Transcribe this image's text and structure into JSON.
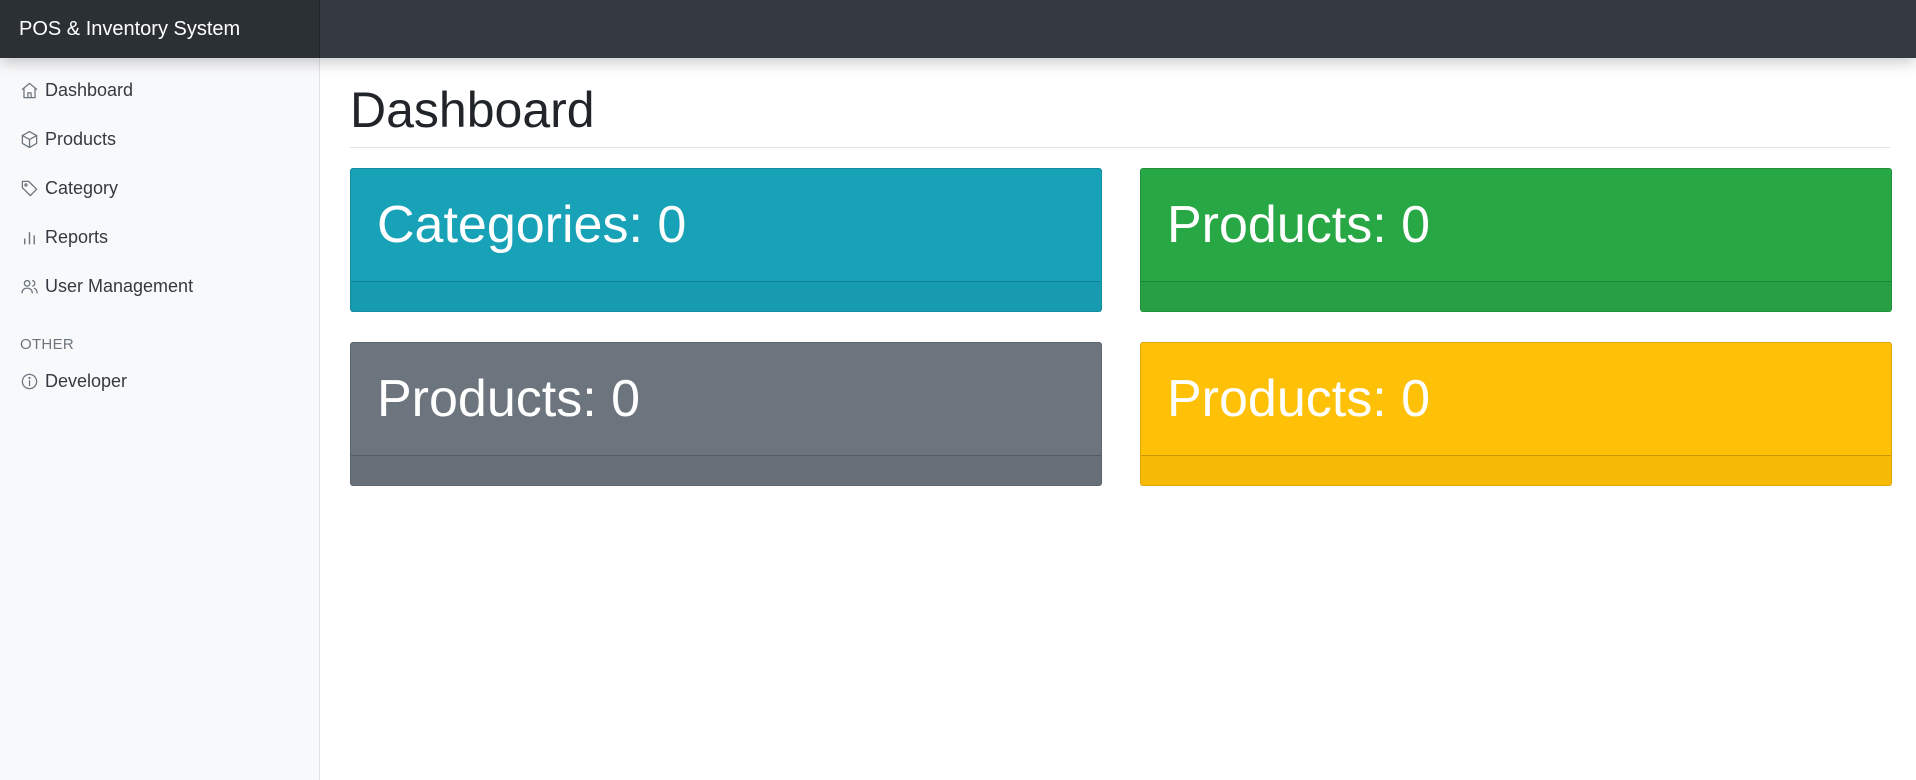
{
  "app": {
    "brand": "POS & Inventory System"
  },
  "sidebar": {
    "items": [
      {
        "label": "Dashboard",
        "icon": "home-icon"
      },
      {
        "label": "Products",
        "icon": "box-icon"
      },
      {
        "label": "Category",
        "icon": "tag-icon"
      },
      {
        "label": "Reports",
        "icon": "bar-chart-icon"
      },
      {
        "label": "User Management",
        "icon": "users-icon"
      }
    ],
    "section_other": "OTHER",
    "other_items": [
      {
        "label": "Developer",
        "icon": "info-icon"
      }
    ]
  },
  "main": {
    "title": "Dashboard",
    "cards": [
      {
        "text": "Categories: 0",
        "color": "#17a2b8"
      },
      {
        "text": "Products: 0",
        "color": "#28a745"
      },
      {
        "text": "Products: 0",
        "color": "#6c757d"
      },
      {
        "text": "Products: 0",
        "color": "#ffc107"
      }
    ]
  }
}
